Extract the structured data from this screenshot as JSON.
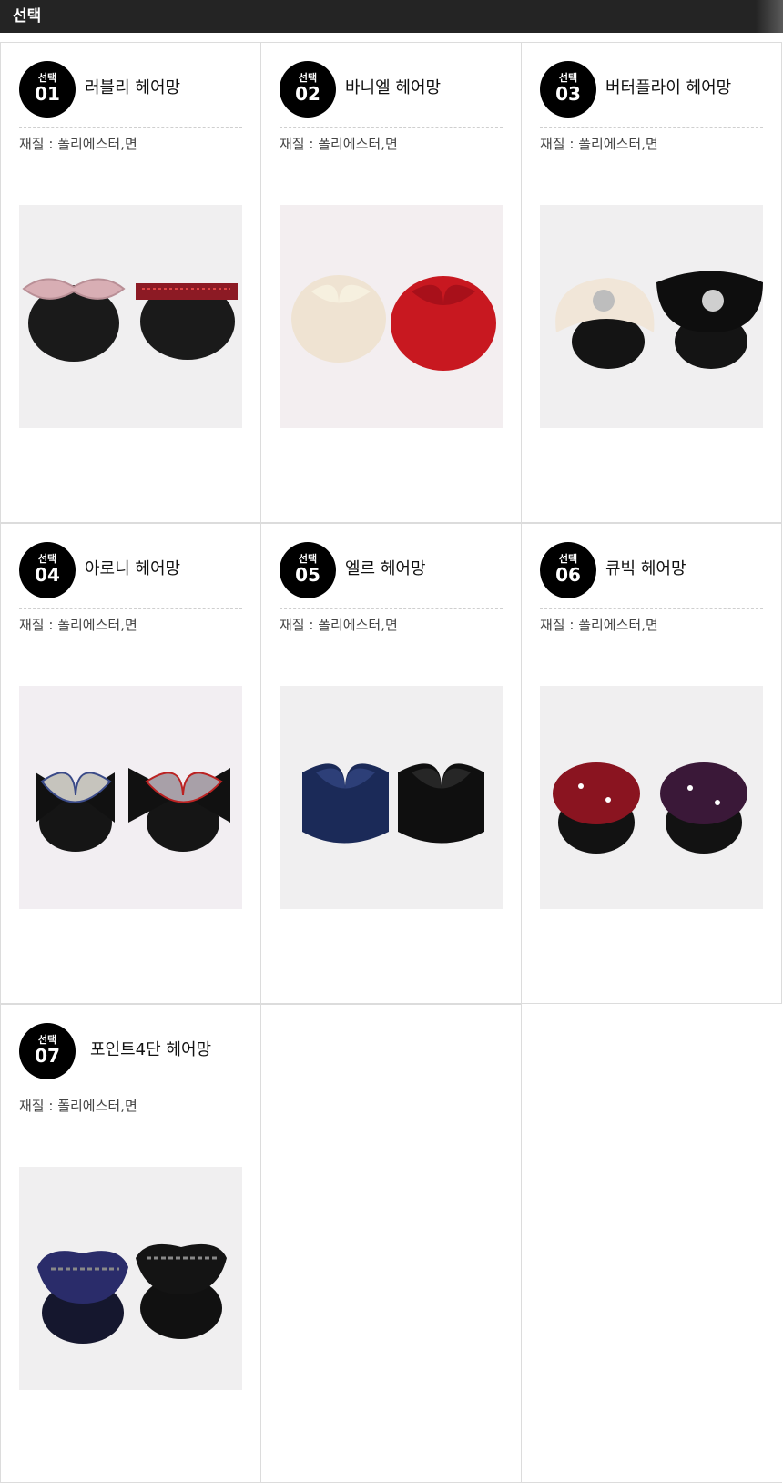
{
  "header": {
    "title": "선택"
  },
  "option_badge_label": "선택",
  "products": [
    {
      "number": "01",
      "name": "러블리 헤어망",
      "material": "재질 : 폴리에스터,면"
    },
    {
      "number": "02",
      "name": "바니엘 헤어망",
      "material": "재질 : 폴리에스터,면"
    },
    {
      "number": "03",
      "name": "버터플라이 헤어망",
      "material": "재질 : 폴리에스터,면"
    },
    {
      "number": "04",
      "name": "아로니 헤어망",
      "material": "재질 : 폴리에스터,면"
    },
    {
      "number": "05",
      "name": "엘르 헤어망",
      "material": "재질 : 폴리에스터,면"
    },
    {
      "number": "06",
      "name": "큐빅 헤어망",
      "material": "재질 : 폴리에스터,면"
    },
    {
      "number": "07",
      "name": "포인트4단 헤어망",
      "material": "재질 : 폴리에스터,면"
    }
  ]
}
